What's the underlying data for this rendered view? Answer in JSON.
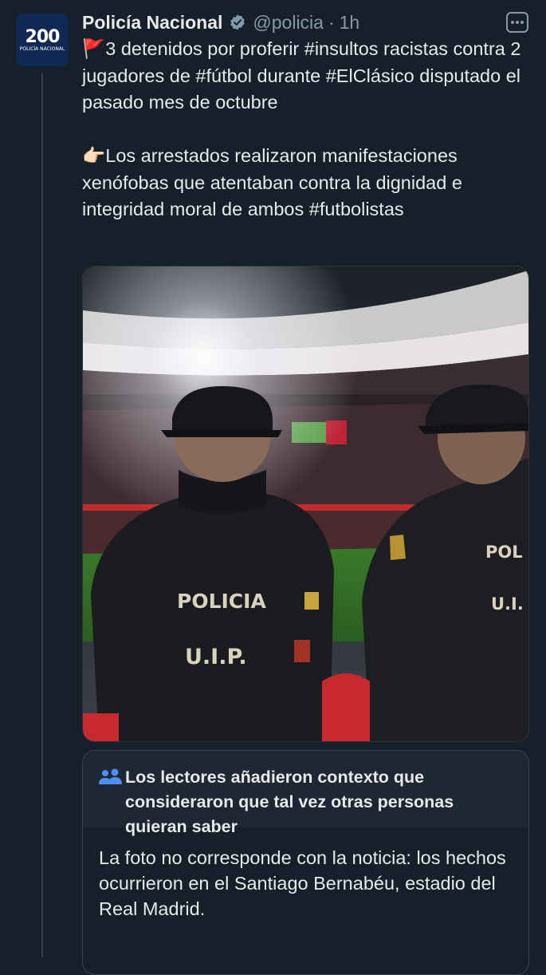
{
  "tweet": {
    "author_name": "Policía Nacional",
    "handle": "@policia",
    "separator": "·",
    "time": "1h",
    "avatar_text": "200",
    "avatar_subtext": "POLICÍA NACIONAL",
    "text": "🚩3 detenidos por proferir #insultos racistas contra 2 jugadores de #fútbol durante #ElClásico disputado el pasado mes de octubre\n\n👉🏻Los arrestados realizaron manifestaciones xenófobas que atentaban contra la dignidad e integridad moral de ambos #futbolistas",
    "photo": {
      "vest_left_line1": "POLICIA",
      "vest_left_line2": "U.I.P.",
      "vest_right_line1": "POL",
      "vest_right_line2": "U.I."
    }
  },
  "community_note": {
    "icon": "users-icon",
    "title": "Los lectores añadieron contexto que consideraron que tal vez otras personas quieran saber",
    "body": "La foto no corresponde con la noticia: los hechos ocurrieron en el Santiago Bernabéu, estadio del Real Madrid."
  },
  "colors": {
    "background": "#15202b",
    "text": "#e7e9ea",
    "secondary_text": "#8b98a5",
    "note_header": "#1e2732",
    "verified_gray": "#829aab"
  }
}
